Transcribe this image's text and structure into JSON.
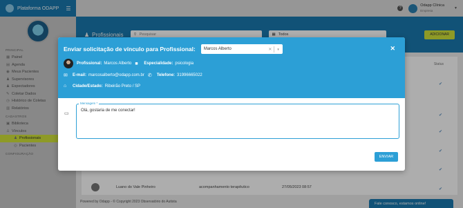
{
  "sidebar": {
    "app_title": "Plataforma ODAPP",
    "sections": {
      "principal": "PRINCIPAL",
      "cadastros": "CADASTROS",
      "configuracao": "CONFIGURAÇÃO"
    },
    "items": [
      {
        "label": "Painel",
        "icon": "grid-icon"
      },
      {
        "label": "Agenda",
        "icon": "calendar-icon"
      },
      {
        "label": "Meus Pacientes",
        "icon": "users-icon"
      },
      {
        "label": "Supervisores",
        "icon": "supervisor-icon"
      },
      {
        "label": "Espectadores",
        "icon": "viewer-icon"
      },
      {
        "label": "Coletar Dados",
        "icon": "edit-icon"
      },
      {
        "label": "Histórico de Coletas",
        "icon": "history-icon"
      },
      {
        "label": "Relatórios",
        "icon": "report-icon"
      },
      {
        "label": "Biblioteca",
        "icon": "library-icon"
      },
      {
        "label": "Vínculos",
        "icon": "link-icon"
      },
      {
        "label": "Profissionais",
        "icon": "professional-icon"
      },
      {
        "label": "Pacientes",
        "icon": "patient-icon"
      }
    ]
  },
  "topbar": {
    "user_name": "Odapp Clínica",
    "user_role": "Empresa"
  },
  "content": {
    "page_title": "Profissionais",
    "search_placeholder": "Pesquisar",
    "filter_value": "Todos",
    "add_button": "ADICIONAR",
    "status_header": "Status",
    "bottom_row": {
      "name": "Luano do Vale Pinheiro",
      "specialty": "acompanhamento terapêutico",
      "date": "27/05/2023 08:57"
    },
    "footer": "Powered by Odapp - © Copyright 2023 Observatório do Autista",
    "chat": "Fale conosco, estamos online!"
  },
  "modal": {
    "title": "Enviar solicitação de vínculo para Profissional:",
    "selected_professional": "Marcos Alberto",
    "professional_label": "Profissional:",
    "professional_value": "Marcos Alberto",
    "specialty_label": "Especialidade:",
    "specialty_value": "psicologia",
    "email_label": "E-mail:",
    "email_value": "marcosalberto@odapp.com.br",
    "phone_label": "Telefone:",
    "phone_value": "31996665022",
    "city_label": "Cidade/Estado:",
    "city_value": "Ribeirão Preto / SP",
    "message_label": "Mensagem *",
    "message_value": "Olá, gostaria de me conectar!",
    "send_button": "ENVIAR"
  },
  "colors": {
    "brand_blue": "#1a7ab0",
    "modal_blue": "#2c9fd6",
    "accent_lime": "#d2e43a"
  }
}
